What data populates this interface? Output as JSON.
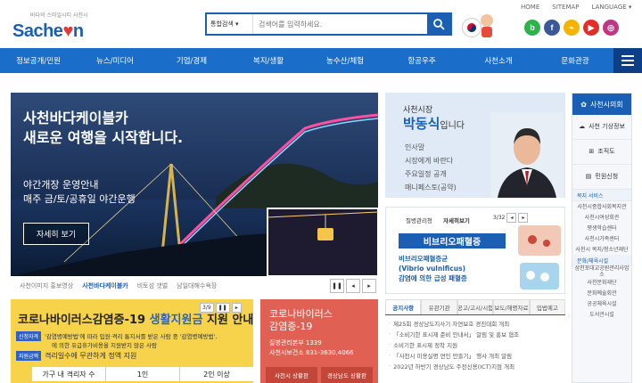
{
  "util": {
    "home": "HOME",
    "sitemap": "SITEMAP",
    "language": "LANGUAGE ▾"
  },
  "logo": {
    "tagline": "바다의 스마일시티 사천시",
    "word_a": "Sache",
    "heart": "♥",
    "word_b": "n"
  },
  "search": {
    "category": "통합검색 ▾",
    "placeholder": "검색어를 입력하세요."
  },
  "sns": [
    {
      "letter": "b",
      "color": "#2db34a"
    },
    {
      "letter": "f",
      "color": "#3b5998"
    },
    {
      "letter": "⌁",
      "color": "#f5b400"
    },
    {
      "letter": "▶",
      "color": "#e52d27"
    },
    {
      "letter": "◎",
      "color": "#c13584"
    }
  ],
  "nav": [
    "정보공개/민원",
    "뉴스/미디어",
    "기업/경제",
    "복지/생활",
    "농수산/체험",
    "항공우주",
    "사천소개",
    "문화관광"
  ],
  "banner": {
    "title1": "사천바다케이블카",
    "title2": "새로운 여행을 시작합니다.",
    "sub1": "야간개장 운영안내",
    "sub2": "매주 금/토/공휴일 야간운행",
    "button": "자세히 보기",
    "tabs": [
      "사천이미지 홍보영상",
      "사천바다케이블카",
      "비토섬 갯벌",
      "남일대해수욕장"
    ],
    "pause": "❚❚",
    "prev": "◂",
    "next": "▸"
  },
  "mayor": {
    "role": "사천시장",
    "name": "박동식",
    "suffix": "입니다",
    "links": [
      "인사말",
      "시장에게 바란다",
      "주요일정 공개",
      "매니페스토(공약)"
    ]
  },
  "health": {
    "org": "질병관리청",
    "tab": "자세히보기",
    "page": "3/32",
    "prev": "◂",
    "next": "▸",
    "title": "비브리오패혈증",
    "line1": "비브리오패혈증균",
    "line2": "(Vibrio vulnificus)",
    "line3": "감염에 의한 급성 패혈증"
  },
  "quick": {
    "council": "사천시의회",
    "items": [
      "사천 기상정보",
      "조직도",
      "민원신청"
    ],
    "cat1": "복지 서비스",
    "cat1_items": [
      "사천시종합사회복지관",
      "사천시여성회관",
      "평생학습센터",
      "사천시가족센터",
      "사천시 복지/청소년재단"
    ],
    "cat2": "문화/체육시설",
    "cat2_items": [
      "삼천포대교공원관리사업소",
      "사천문화재단",
      "문화예술회관",
      "공공체육시설",
      "도서관시설"
    ]
  },
  "corona": {
    "head_a": "코로나바이러스감염증-19",
    "head_b": "생활지원금",
    "head_c": "지원 안내",
    "row1_tag": "신청자격",
    "row1": "'감염병예방법'에 따라 입원·격리 통지서를 받은 사람 중 '감염병예방법',",
    "row1b": "에 의한 유급휴가비용을 지원받지 않은 사람",
    "row2_tag": "지원금액",
    "row2": "격리일수에 무관하게 정액 지원",
    "table": [
      "가구 내 격리자 수",
      "1인",
      "2인 이상"
    ],
    "page": "3/9",
    "pause": "❚❚",
    "next": "▸"
  },
  "covid": {
    "t1": "코로나바이러스",
    "t2": "감염증-19",
    "info1": "질병관리본부 1339",
    "info2": "사천시보건소 831-3630,4066",
    "btn1": "사천시 상황판",
    "btn2": "경상남도 상황판"
  },
  "board": {
    "tabs": [
      "공지사항",
      "유관기관",
      "공고/고시/시험",
      "보도/해명자료",
      "입법예고"
    ],
    "items": [
      "제25회 경상남도지사기 자연보호 경진대회 개최",
      "「소비기한 표시제 준비 안내서」 알림 및 홍보 협조",
      "소비기한 표시제 정착 지원",
      "「사천시 미용실명 연인 만들기」 행사 개최 알림",
      "2022년 하반기 경상남도 주전신용(ICT)지점 개최"
    ]
  }
}
